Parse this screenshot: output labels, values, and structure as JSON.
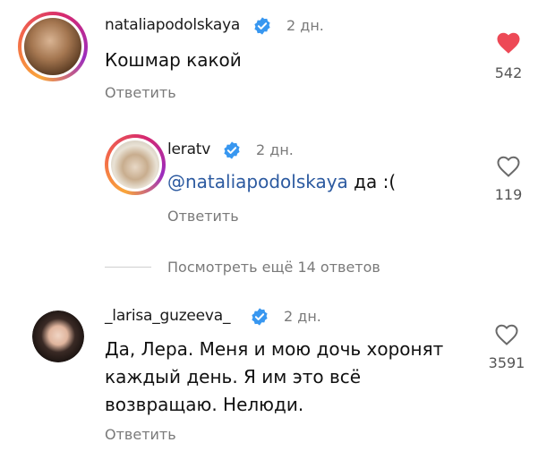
{
  "comments": [
    {
      "username": "nataliapodolskaya",
      "time": "2 дн.",
      "text": "Кошмар какой",
      "reply_label": "Ответить",
      "likes": "542",
      "liked": true,
      "avatar_icon": "story-ring-avatar"
    },
    {
      "username": "leratv",
      "time": "2 дн.",
      "mention": "@nataliapodolskaya",
      "text": " да :(",
      "reply_label": "Ответить",
      "likes": "119",
      "liked": false,
      "avatar_icon": "story-ring-avatar"
    },
    {
      "username": "_larisa_guzeeva_",
      "time": "2 дн.",
      "text_lines": [
        "Да, Лера. Меня и мою дочь хоронят",
        "каждый день. Я им это всё",
        "возвращаю. Нелюди."
      ],
      "reply_label": "Ответить",
      "likes": "3591",
      "liked": false,
      "avatar_icon": "avatar"
    }
  ],
  "view_more": "Посмотреть ещё 14 ответов",
  "colors": {
    "verified": "#3897f0",
    "liked": "#ed4956",
    "mention": "#2c5aa0"
  },
  "icons": {
    "verified": "verified-badge-icon",
    "heart_filled": "heart-filled-icon",
    "heart_outline": "heart-outline-icon"
  }
}
